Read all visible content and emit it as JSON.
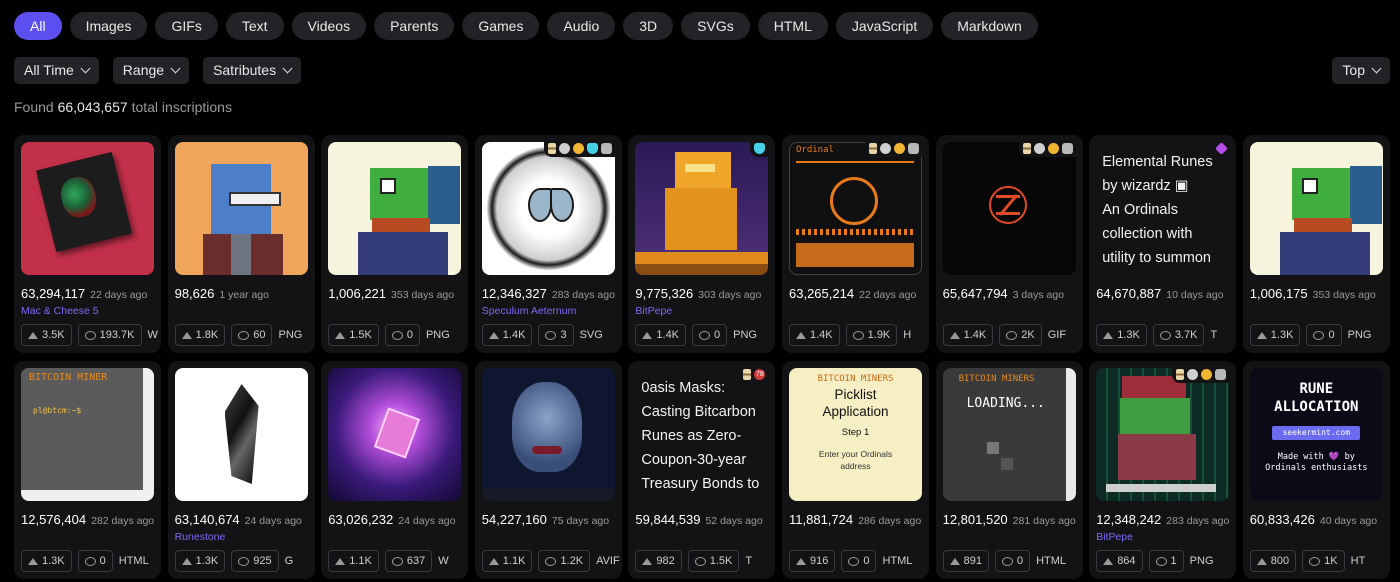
{
  "tabs": [
    "All",
    "Images",
    "GIFs",
    "Text",
    "Videos",
    "Parents",
    "Games",
    "Audio",
    "3D",
    "SVGs",
    "HTML",
    "JavaScript",
    "Markdown"
  ],
  "filters": {
    "time": "All Time",
    "range": "Range",
    "satributes": "Satributes",
    "sort": "Top"
  },
  "summary": {
    "prefix": "Found",
    "count": "66,043,657",
    "suffix": "total inscriptions"
  },
  "cards": [
    {
      "number": "63,294,117",
      "age": "22 days ago",
      "collection": "Mac & Cheese 5",
      "likes": "3.5K",
      "comments": "193.7K",
      "type": "W"
    },
    {
      "number": "98,626",
      "age": "1 year ago",
      "collection": "",
      "likes": "1.8K",
      "comments": "60",
      "type": "PNG"
    },
    {
      "number": "1,006,221",
      "age": "353 days ago",
      "collection": "",
      "likes": "1.5K",
      "comments": "0",
      "type": "PNG"
    },
    {
      "number": "12,346,327",
      "age": "283 days ago",
      "collection": "Speculum Aeternum",
      "likes": "1.4K",
      "comments": "3",
      "type": "SVG"
    },
    {
      "number": "9,775,326",
      "age": "303 days ago",
      "collection": "BitPepe",
      "likes": "1.4K",
      "comments": "0",
      "type": "PNG"
    },
    {
      "number": "63,265,214",
      "age": "22 days ago",
      "collection": "",
      "likes": "1.4K",
      "comments": "1.9K",
      "type": "H"
    },
    {
      "number": "65,647,794",
      "age": "3 days ago",
      "collection": "",
      "likes": "1.4K",
      "comments": "2K",
      "type": "GIF"
    },
    {
      "number": "64,670,887",
      "age": "10 days ago",
      "collection": "",
      "likes": "1.3K",
      "comments": "3.7K",
      "type": "T"
    },
    {
      "number": "1,006,175",
      "age": "353 days ago",
      "collection": "",
      "likes": "1.3K",
      "comments": "0",
      "type": "PNG"
    },
    {
      "number": "12,576,404",
      "age": "282 days ago",
      "collection": "",
      "likes": "1.3K",
      "comments": "0",
      "type": "HTML"
    },
    {
      "number": "63,140,674",
      "age": "24 days ago",
      "collection": "Runestone",
      "likes": "1.3K",
      "comments": "925",
      "type": "G"
    },
    {
      "number": "63,026,232",
      "age": "24 days ago",
      "collection": "",
      "likes": "1.1K",
      "comments": "637",
      "type": "W"
    },
    {
      "number": "54,227,160",
      "age": "75 days ago",
      "collection": "",
      "likes": "1.1K",
      "comments": "1.2K",
      "type": "AVIF"
    },
    {
      "number": "59,844,539",
      "age": "52 days ago",
      "collection": "",
      "likes": "982",
      "comments": "1.5K",
      "type": "T"
    },
    {
      "number": "11,881,724",
      "age": "286 days ago",
      "collection": "",
      "likes": "916",
      "comments": "0",
      "type": "HTML"
    },
    {
      "number": "12,801,520",
      "age": "281 days ago",
      "collection": "",
      "likes": "891",
      "comments": "0",
      "type": "HTML"
    },
    {
      "number": "12,348,242",
      "age": "283 days ago",
      "collection": "BitPepe",
      "likes": "864",
      "comments": "1",
      "type": "PNG"
    },
    {
      "number": "60,833,426",
      "age": "40 days ago",
      "collection": "",
      "likes": "800",
      "comments": "1K",
      "type": "HT"
    }
  ],
  "text_previews": {
    "elemental": [
      "Elemental Runes",
      "by wizardz ▣",
      "An Ordinals",
      "collection with",
      "utility to summon"
    ],
    "oasis": [
      "0asis Masks:",
      "Casting Bitcarbon",
      "Runes as Zero-",
      "Coupon-30-year",
      "Treasury Bonds to"
    ],
    "ordinal_panel": "Ordinal",
    "btc_terminal": {
      "title": "BITCOIN MINER",
      "prompt": "pl@btcm:~$"
    },
    "picklist": {
      "header": "BITCOIN MINERS",
      "title": "Picklist Application",
      "step": "Step 1",
      "body": "Enter your Ordinals address"
    },
    "loading": {
      "header": "BITCOIN MINERS",
      "text": "LOADING..."
    },
    "rune": {
      "title": "RUNE ALLOCATION",
      "url": "seekermint.com",
      "made_with": "Made with",
      "heart": "💜",
      "by": "by",
      "by_line": "Ordinals enthusiasts"
    },
    "red_badge": "78"
  }
}
